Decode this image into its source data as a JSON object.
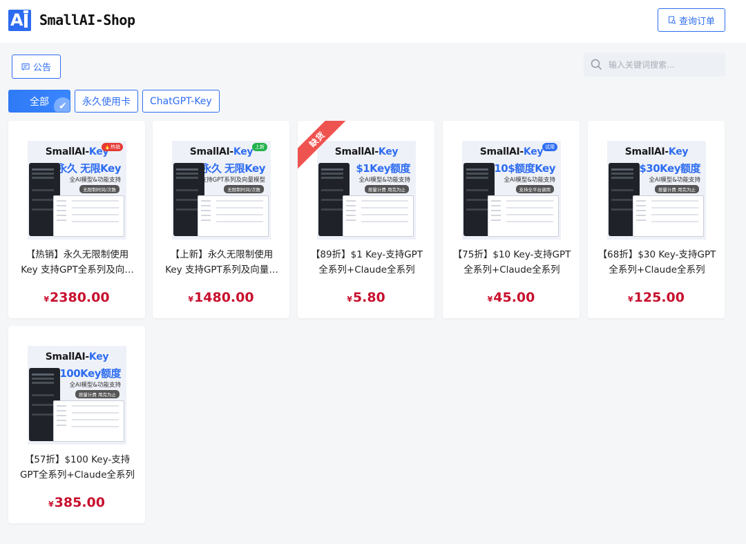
{
  "header": {
    "brand": "SmallAI-Shop",
    "order_button": "查询订单",
    "colors": {
      "primary": "#2d6cf0",
      "price": "#c8102e"
    }
  },
  "toolbar": {
    "notice_button": "公告",
    "search_placeholder": "输入关键词搜索..."
  },
  "categories": [
    {
      "label": "全部",
      "active": true
    },
    {
      "label": "永久使用卡",
      "active": false
    },
    {
      "label": "ChatGPT-Key",
      "active": false
    }
  ],
  "products": [
    {
      "thumb_title_a": "SmallAI-",
      "thumb_title_b": "Key",
      "badge": "🔥热销",
      "badge_color": "#e53935",
      "headline": "永久 无限Key",
      "sub": "全AI模型&功能支持",
      "pill": "无限制时间/次数",
      "ribbon": "",
      "name": "【热销】永久无限制使用Key 支持GPT全系列及向量模型",
      "currency": "¥",
      "price": "2380.00"
    },
    {
      "thumb_title_a": "SmallAI-",
      "thumb_title_b": "Key",
      "badge": "上新",
      "badge_color": "#22b14c",
      "headline": "永久 无限Key",
      "sub": "仅支持GPT系列及向量模型",
      "pill": "无限制时间/次数",
      "ribbon": "",
      "name": "【上新】永久无限制使用Key 支持GPT系列及向量模型",
      "currency": "¥",
      "price": "1480.00"
    },
    {
      "thumb_title_a": "SmallAI-",
      "thumb_title_b": "Key",
      "badge": "",
      "badge_color": "",
      "headline": "$1Key额度",
      "sub": "全AI模型&功能支持",
      "pill": "按量计费 用完为止",
      "ribbon": "缺货",
      "name": "【89折】$1 Key-支持GPT全系列+Claude全系列",
      "currency": "¥",
      "price": "5.80"
    },
    {
      "thumb_title_a": "SmallAI-",
      "thumb_title_b": "Key",
      "badge": "试用",
      "badge_color": "#2d6cf0",
      "headline": "10$额度Key",
      "sub": "全AI模型&功能支持",
      "pill": "支持全平台调用",
      "ribbon": "",
      "name": "【75折】$10 Key-支持GPT全系列+Claude全系列",
      "currency": "¥",
      "price": "45.00"
    },
    {
      "thumb_title_a": "SmallAI-",
      "thumb_title_b": "Key",
      "badge": "",
      "badge_color": "",
      "headline": "$30Key额度",
      "sub": "全AI模型&功能支持",
      "pill": "按量计费 用完为止",
      "ribbon": "",
      "name": "【68折】$30 Key-支持GPT全系列+Claude全系列",
      "currency": "¥",
      "price": "125.00"
    },
    {
      "thumb_title_a": "SmallAI-",
      "thumb_title_b": "Key",
      "badge": "",
      "badge_color": "",
      "headline": "$100Key额度",
      "sub": "全AI模型&功能支持",
      "pill": "按量计费 用完为止",
      "ribbon": "",
      "name": "【57折】$100 Key-支持GPT全系列+Claude全系列",
      "currency": "¥",
      "price": "385.00"
    }
  ]
}
